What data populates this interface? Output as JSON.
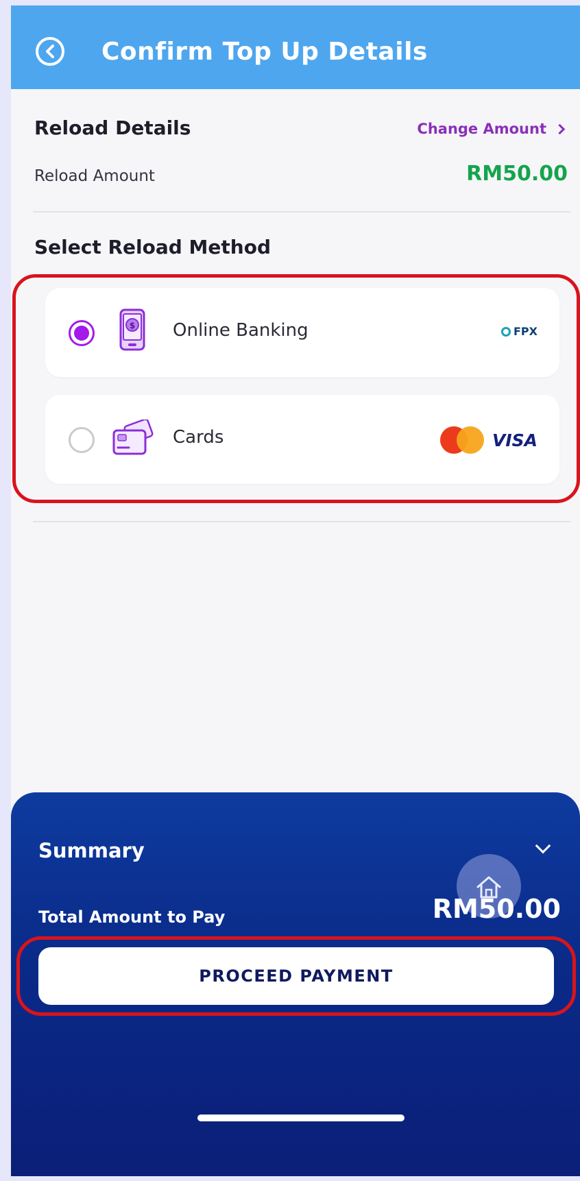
{
  "header": {
    "title": "Confirm Top Up Details",
    "back_icon": "chevron-left-circle-icon"
  },
  "reload_details": {
    "title": "Reload Details",
    "change_amount_label": "Change Amount",
    "amount_label": "Reload Amount",
    "amount_value": "RM50.00"
  },
  "reload_method": {
    "title": "Select Reload Method",
    "methods": [
      {
        "label": "Online Banking",
        "selected": true,
        "icon": "phone-payment-icon",
        "provider": "FPX"
      },
      {
        "label": "Cards",
        "selected": false,
        "icon": "credit-card-icon",
        "provider": "VISA"
      }
    ]
  },
  "summary": {
    "title": "Summary",
    "total_label": "Total Amount to Pay",
    "total_value": "RM50.00",
    "proceed_label": "PROCEED PAYMENT"
  },
  "colors": {
    "header": "#4ea6ef",
    "accent_purple": "#a31be8",
    "amount_green": "#14a44d",
    "summary_blue": "#0a2a88",
    "highlight_red": "#d9141c"
  }
}
